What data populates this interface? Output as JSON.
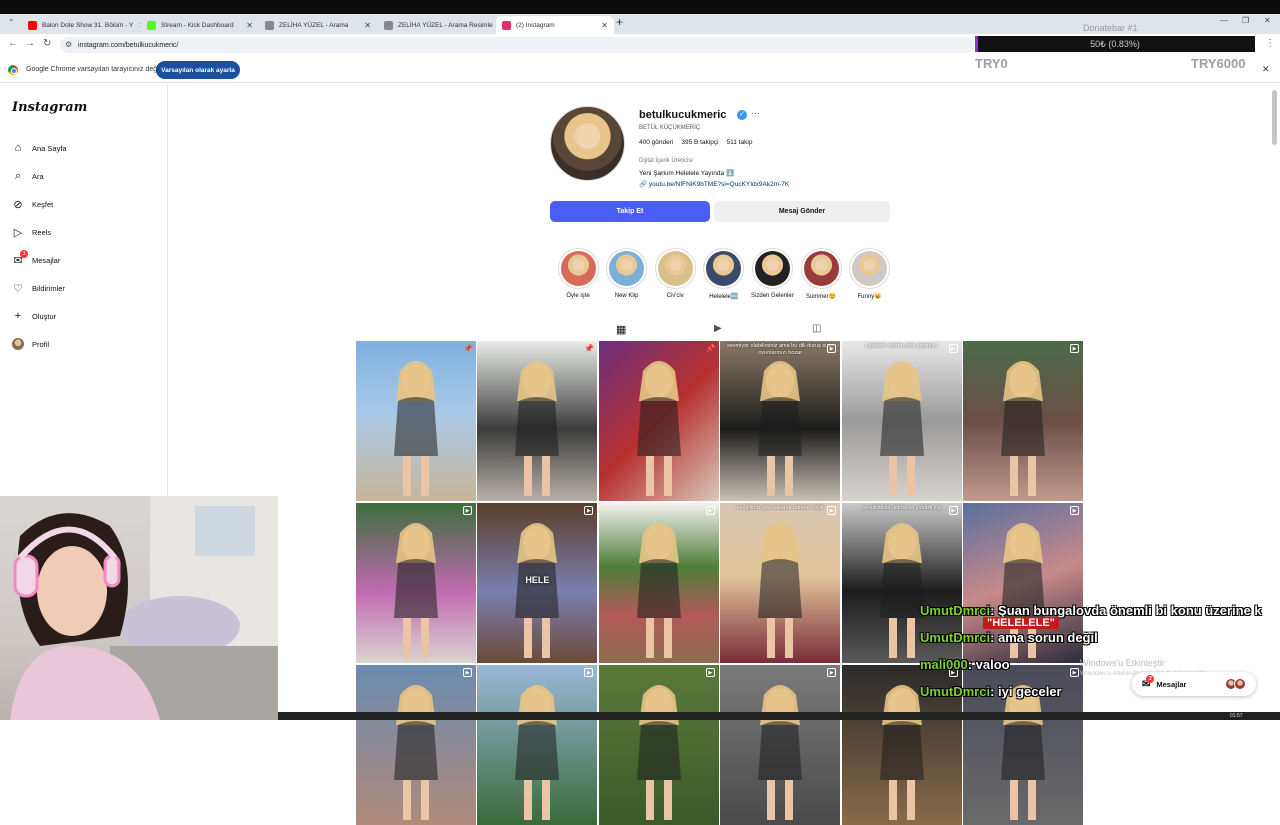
{
  "browser": {
    "tabs": [
      {
        "title": "Balon Dote Show 31. Bölüm - Y",
        "favicon_color": "#ff0000"
      },
      {
        "title": "Stream - Kick Dashboard",
        "favicon_color": "#53fc18"
      },
      {
        "title": "ZELİHA YÜZEL - Arama",
        "favicon_color": "#888888"
      },
      {
        "title": "ZELİHA YÜZEL - Arama Resimle",
        "favicon_color": "#888888"
      },
      {
        "title": "(2) Instagram",
        "favicon_color": "#e1306c"
      }
    ],
    "url": "instagram.com/betulkucukmeric/",
    "infobar_text": "Google Chrome varsayılan tarayıcınız değil",
    "infobar_button": "Varsayılan olarak ayarla"
  },
  "donatebar": {
    "title": "Donatebar #1",
    "progress_text": "50₺ (0.83%)",
    "progress_percent": 0.83,
    "min_label": "TRY0",
    "max_label": "TRY6000",
    "fill_color": "#9b2bd8"
  },
  "sidebar": {
    "logo": "Instagram",
    "items": [
      {
        "label": "Ana Sayfa",
        "icon": "home-icon"
      },
      {
        "label": "Ara",
        "icon": "search-icon"
      },
      {
        "label": "Keşfet",
        "icon": "compass-icon"
      },
      {
        "label": "Reels",
        "icon": "reels-icon"
      },
      {
        "label": "Mesajlar",
        "icon": "messenger-icon",
        "badge": "3"
      },
      {
        "label": "Bildirimler",
        "icon": "heart-icon"
      },
      {
        "label": "Oluştur",
        "icon": "plus-icon"
      },
      {
        "label": "Profil",
        "icon": "avatar"
      }
    ]
  },
  "profile": {
    "username": "betulkucukmeric",
    "full_name": "BETÜL KÜÇÜKMERİÇ",
    "stats": {
      "posts": "400 gönderi",
      "followers": "395 B takipçi",
      "following": "511 takip"
    },
    "category": "Dijital İçerik Üreticisi",
    "bio": "Yeni Şarkım Helelele Yayında ⬇️",
    "link": "youtu.be/NfFNiK9bTME?si=QucKYIdx9Ak2m-7K",
    "follow_button": "Takip Et",
    "message_button": "Mesaj Gönder"
  },
  "highlights": [
    {
      "label": "Öyle işte",
      "color": "#d86a5a"
    },
    {
      "label": "New Klip",
      "color": "#7ab0d8"
    },
    {
      "label": "Civ'civ",
      "color": "#d9c08a"
    },
    {
      "label": "Helelele🆕",
      "color": "#3b4a6a"
    },
    {
      "label": "Sizden Gelenler",
      "color": "#222222"
    },
    {
      "label": "Summer☺️",
      "color": "#9a3b3b"
    },
    {
      "label": "Funny😺",
      "color": "#cfc9c6"
    }
  ],
  "grid": {
    "posts": [
      {
        "caption": "",
        "icon": "pin-icon",
        "bg": "linear-gradient(180deg,#7fb0e0 0%,#a9c9e8 45%,#c7b59a 100%)"
      },
      {
        "caption": "",
        "icon": "pin-icon",
        "bg": "linear-gradient(180deg,#e9ece9 0%,#3c3c3c 55%,#b7b1a8 100%)"
      },
      {
        "caption": "",
        "icon": "pin-icon",
        "bg": "linear-gradient(135deg,#6c2f7d 0%,#b73030 50%,#d9c8b8 100%)"
      },
      {
        "caption": "sevmiyor olabilirsiniz ama bu dili duruş sizin oyunlarınızı bozar",
        "icon": "reels-icon",
        "bg": "linear-gradient(180deg,#8a7a66 0%,#1c1c1c 55%,#c9c1b6 100%)"
      },
      {
        "caption": "( şarkımı olarmı sesi yapmış )",
        "icon": "reels-icon",
        "bg": "linear-gradient(180deg,#e8e8e8 0%,#9a9a9a 50%,#d7d3cf 100%)"
      },
      {
        "caption": "",
        "icon": "reels-icon",
        "bg": "linear-gradient(180deg,#4c6b4a 0%,#6b4e46 50%,#c09a8c 100%)"
      },
      {
        "caption": "",
        "icon": "reels-icon",
        "bg": "linear-gradient(180deg,#3d6e3d 0%,#c06ab0 55%,#d9d4d0 100%)"
      },
      {
        "caption": "",
        "icon": "reels-icon",
        "bg": "linear-gradient(180deg,#5a3e2a 0%,#7a7fb0 55%,#6c4a3a 100%)",
        "big": "HELE"
      },
      {
        "caption": "",
        "icon": "reels-icon",
        "bg": "linear-gradient(180deg,#f3f1ee 0%,#4e7d3a 40%,#b35959 70%,#8a6d50 100%)"
      },
      {
        "caption": "sevgilimiz gibi sakarak datene ciktik",
        "icon": "reels-icon",
        "bg": "linear-gradient(180deg,#d9c7b5 0%,#e2c59a 45%,#7a2c3a 100%)"
      },
      {
        "caption": "sevgilimizle dolma ve yaldizli sig",
        "icon": "reels-icon",
        "bg": "linear-gradient(180deg,#c9c9c9 0%,#1c1c1c 55%,#5a5a5a 100%)"
      },
      {
        "caption": "",
        "icon": "reels-icon",
        "bg": "linear-gradient(160deg,#5a6fa0 0%,#c78a8a 50%,#2b2b3b 100%)"
      },
      {
        "caption": "",
        "icon": "reels-icon",
        "bg": "linear-gradient(180deg,#6a8bb0 0%,#b08a7a 100%)"
      },
      {
        "caption": "",
        "icon": "reels-icon",
        "bg": "linear-gradient(180deg,#9ab8d8 0%,#3a6a3a 100%)"
      },
      {
        "caption": "",
        "icon": "reels-icon",
        "bg": "linear-gradient(180deg,#5a7a3a 0%,#3a5a2a 100%)"
      },
      {
        "caption": "",
        "icon": "reels-icon",
        "bg": "linear-gradient(180deg,#7a7a7a 0%,#4a4a4a 100%)"
      },
      {
        "caption": "",
        "icon": "reels-icon",
        "bg": "linear-gradient(180deg,#2a2a2a 0%,#8a6a4a 100%)"
      },
      {
        "caption": "",
        "icon": "reels-icon",
        "bg": "linear-gradient(180deg,#4a4a5a 0%,#6a6a6a 100%)"
      }
    ]
  },
  "chat": {
    "messages": [
      {
        "user": "UmutDmrci",
        "text": ": Şuan bungalovda önemli bi konu üzerine k"
      },
      {
        "user": "UmutDmrci",
        "text": ": ama sorun değil"
      },
      {
        "user": "mali000",
        "text": ": valoo"
      },
      {
        "user": "UmutDmrci",
        "text": ": iyi geceler"
      }
    ],
    "heart_text": "\"HELELELE\""
  },
  "windows": {
    "activate_title": "Windows'u Etkinleştir",
    "activate_sub": "Windows'u etkinleştirmek için Ayarlar'a gidin.",
    "clock": "01:57"
  },
  "messages_pill": {
    "label": "Mesajlar",
    "badge": "2"
  }
}
